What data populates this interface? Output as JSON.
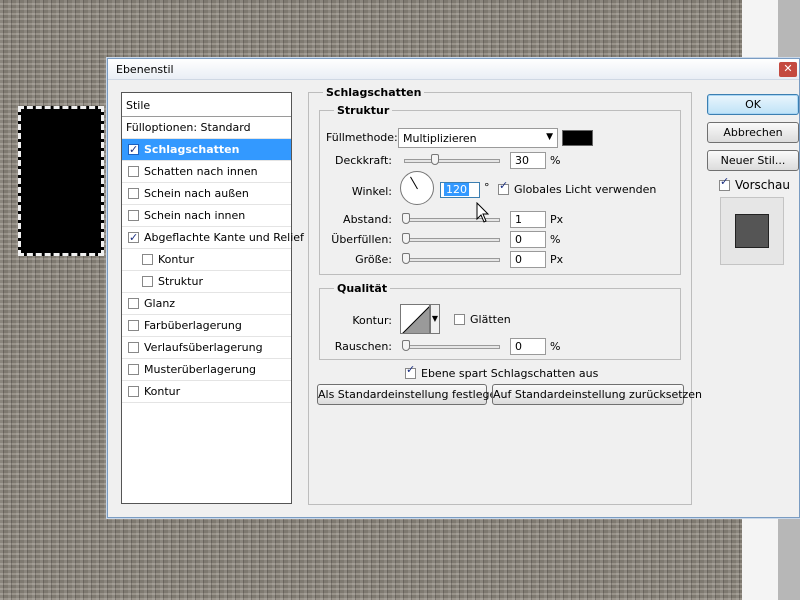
{
  "dialog": {
    "title": "Ebenenstil",
    "close_icon": "close-icon"
  },
  "style_list": {
    "header": "Stile",
    "items": [
      {
        "label": "Fülloptionen: Standard",
        "checkbox": false,
        "checked": false,
        "selected": false,
        "indent": false
      },
      {
        "label": "Schlagschatten",
        "checkbox": true,
        "checked": true,
        "selected": true,
        "indent": false
      },
      {
        "label": "Schatten nach innen",
        "checkbox": true,
        "checked": false,
        "selected": false,
        "indent": false
      },
      {
        "label": "Schein nach außen",
        "checkbox": true,
        "checked": false,
        "selected": false,
        "indent": false
      },
      {
        "label": "Schein nach innen",
        "checkbox": true,
        "checked": false,
        "selected": false,
        "indent": false
      },
      {
        "label": "Abgeflachte Kante und Relief",
        "checkbox": true,
        "checked": true,
        "selected": false,
        "indent": false
      },
      {
        "label": "Kontur",
        "checkbox": true,
        "checked": false,
        "selected": false,
        "indent": true
      },
      {
        "label": "Struktur",
        "checkbox": true,
        "checked": false,
        "selected": false,
        "indent": true
      },
      {
        "label": "Glanz",
        "checkbox": true,
        "checked": false,
        "selected": false,
        "indent": false
      },
      {
        "label": "Farbüberlagerung",
        "checkbox": true,
        "checked": false,
        "selected": false,
        "indent": false
      },
      {
        "label": "Verlaufsüberlagerung",
        "checkbox": true,
        "checked": false,
        "selected": false,
        "indent": false
      },
      {
        "label": "Musterüberlagerung",
        "checkbox": true,
        "checked": false,
        "selected": false,
        "indent": false
      },
      {
        "label": "Kontur",
        "checkbox": true,
        "checked": false,
        "selected": false,
        "indent": false
      }
    ]
  },
  "panel": {
    "title": "Schlagschatten",
    "structure": {
      "title": "Struktur",
      "blend_mode_label": "Füllmethode:",
      "blend_mode_value": "Multiplizieren",
      "shadow_color": "#000000",
      "opacity_label": "Deckkraft:",
      "opacity_value": "30",
      "opacity_unit": "%",
      "opacity_fraction": 0.3,
      "angle_label": "Winkel:",
      "angle_value": "120",
      "angle_unit": "°",
      "global_light_label": "Globales Licht verwenden",
      "global_light_checked": true,
      "distance_label": "Abstand:",
      "distance_value": "1",
      "distance_unit": "Px",
      "spread_label": "Überfüllen:",
      "spread_value": "0",
      "spread_unit": "%",
      "size_label": "Größe:",
      "size_value": "0",
      "size_unit": "Px"
    },
    "quality": {
      "title": "Qualität",
      "contour_label": "Kontur:",
      "antialias_label": "Glätten",
      "antialias_checked": false,
      "noise_label": "Rauschen:",
      "noise_value": "0",
      "noise_unit": "%"
    },
    "knockout_label": "Ebene spart Schlagschatten aus",
    "knockout_checked": true,
    "make_default": "Als Standardeinstellung festlegen",
    "reset_default": "Auf Standardeinstellung zurücksetzen"
  },
  "buttons": {
    "ok": "OK",
    "cancel": "Abbrechen",
    "new_style": "Neuer Stil...",
    "preview_label": "Vorschau",
    "preview_checked": true
  }
}
